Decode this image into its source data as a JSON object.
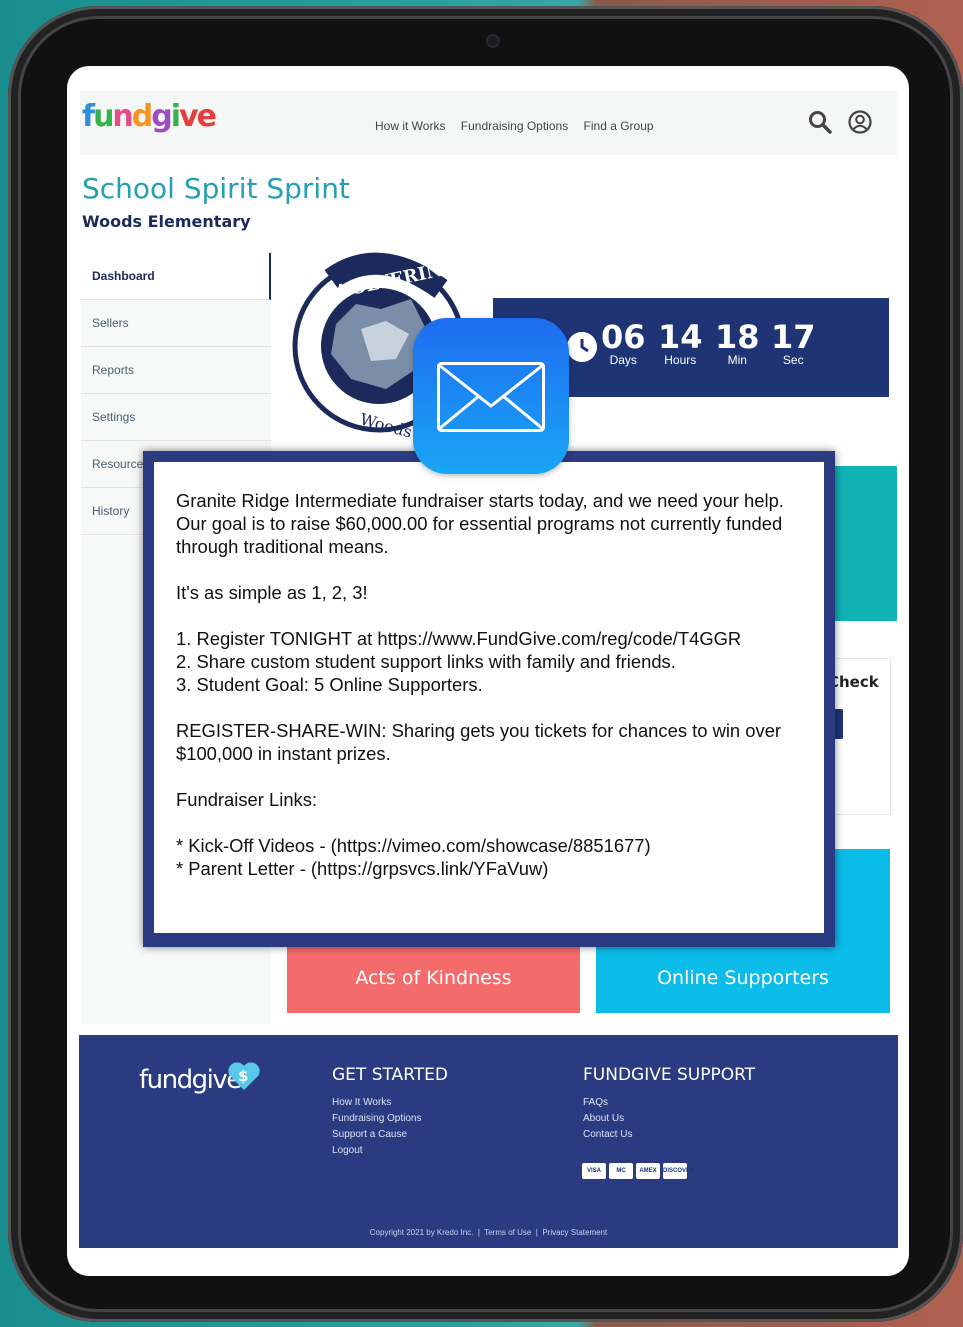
{
  "header": {
    "logo_text": "fundgive",
    "nav": [
      "How it Works",
      "Fundraising Options",
      "Find a Group"
    ]
  },
  "page": {
    "title": "School Spirit Sprint",
    "subtitle": "Woods Elementary"
  },
  "sidebar": {
    "items": [
      {
        "label": "Dashboard",
        "active": true
      },
      {
        "label": "Sellers"
      },
      {
        "label": "Reports"
      },
      {
        "label": "Settings"
      },
      {
        "label": "Resources"
      },
      {
        "label": "History"
      }
    ]
  },
  "badge": {
    "top_text": "WOLVERINE",
    "bottom_text": "Woods Elem"
  },
  "countdown": {
    "units": [
      {
        "value": "06",
        "label": "Days"
      },
      {
        "value": "14",
        "label": "Hours"
      },
      {
        "value": "18",
        "label": "Min"
      },
      {
        "value": "17",
        "label": "Sec"
      }
    ]
  },
  "check_card": {
    "title": "Check"
  },
  "stats": {
    "acts_label": "Acts of Kindness",
    "supporters_label": "Online Supporters"
  },
  "popup": {
    "message": "Granite Ridge Intermediate fundraiser starts today, and we need your help. Our goal is to raise $60,000.00 for essential programs not currently funded through traditional means.\n\nIt's as simple as 1, 2, 3!\n\n1. Register TONIGHT at https://www.FundGive.com/reg/code/T4GGR\n2. Share custom student support links with family and friends.\n3. Student Goal: 5 Online Supporters.\n\nREGISTER-SHARE-WIN: Sharing gets you tickets for chances to win over $100,000 in instant prizes.\n\nFundraiser Links:\n\n* Kick-Off Videos - (https://vimeo.com/showcase/8851677)\n* Parent Letter - (https://grpsvcs.link/YFaVuw)"
  },
  "footer": {
    "logo_text": "fundgive",
    "get_started": {
      "heading": "GET STARTED",
      "links": [
        "How It Works",
        "Fundraising Options",
        "Support a Cause",
        "Logout"
      ]
    },
    "support": {
      "heading": "FUNDGIVE SUPPORT",
      "links": [
        "FAQs",
        "About Us",
        "Contact Us"
      ]
    },
    "payment_cards": [
      "VISA",
      "MC",
      "AMEX",
      "DISCOVER"
    ],
    "copyright": "Copyright 2021 by Kredo Inc.",
    "terms": "Terms of Use",
    "privacy": "Privacy Statement"
  },
  "colors": {
    "navy": "#1e3474",
    "teal": "#11b3b5",
    "coral": "#f46b6b",
    "sky": "#0bbbe8",
    "title_teal": "#24a0b4"
  }
}
